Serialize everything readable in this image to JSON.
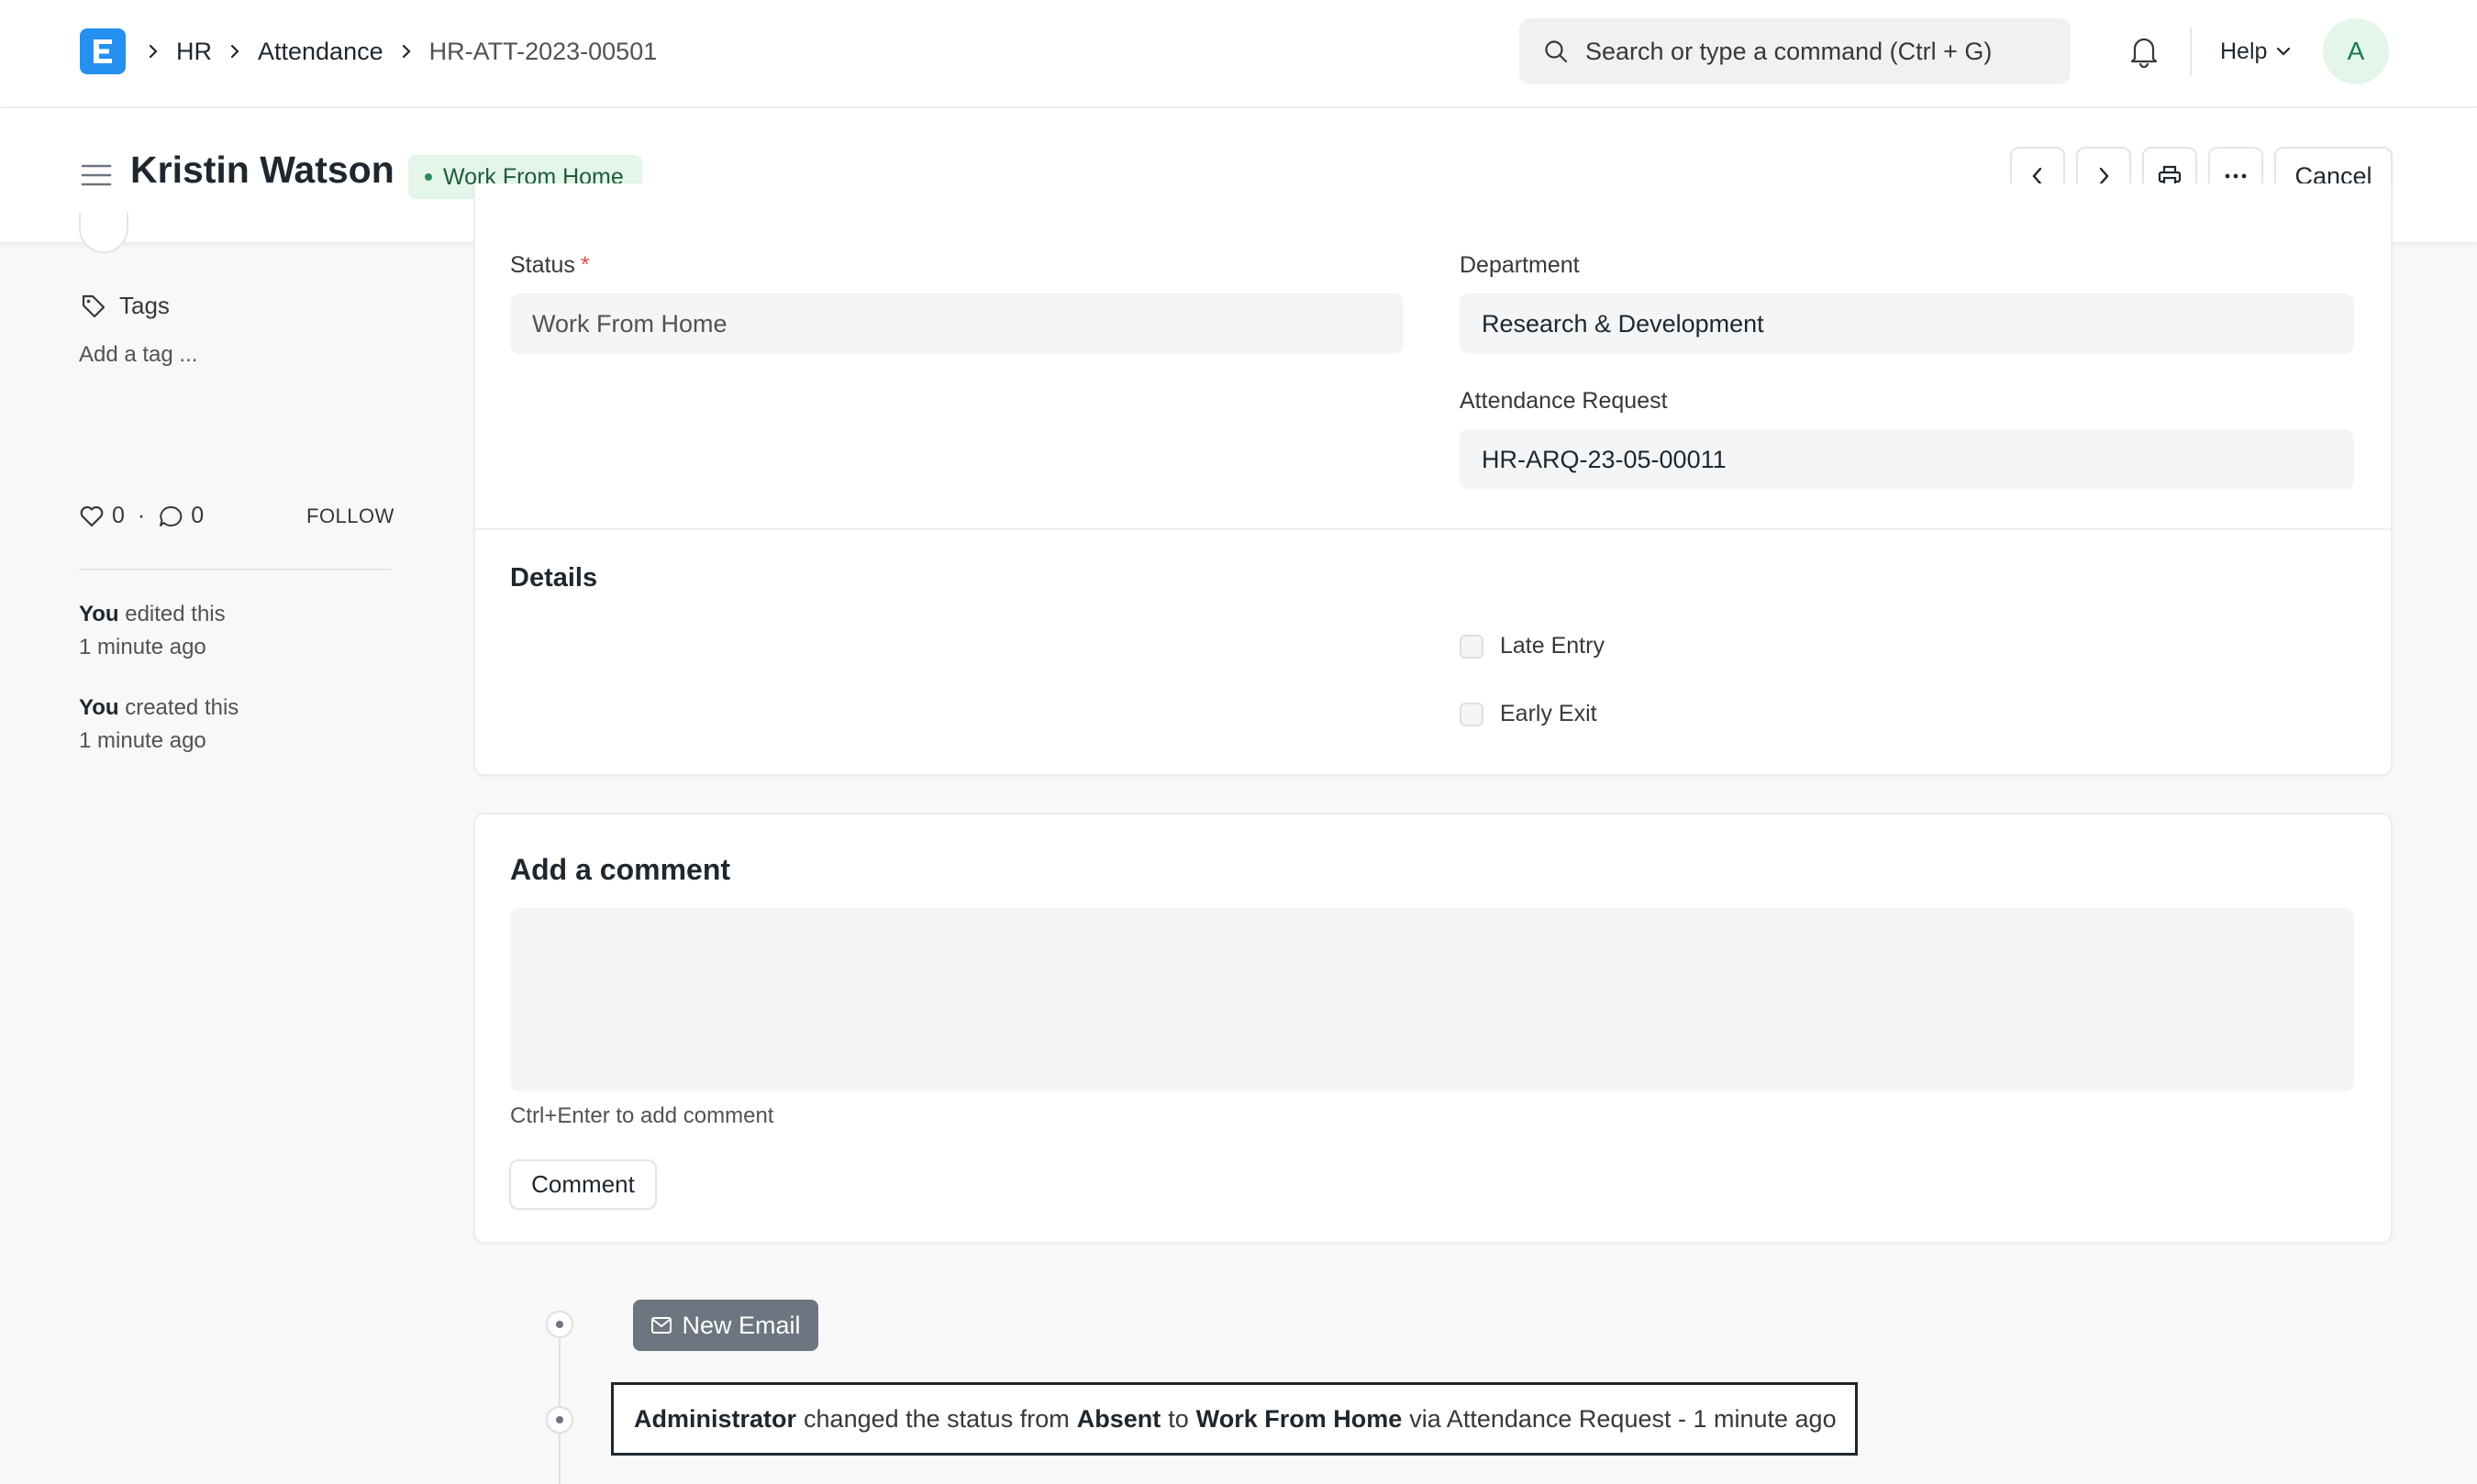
{
  "navbar": {
    "breadcrumbs": [
      "HR",
      "Attendance",
      "HR-ATT-2023-00501"
    ],
    "search_placeholder": "Search or type a command (Ctrl + G)",
    "help_label": "Help",
    "avatar_initial": "A"
  },
  "header": {
    "title": "Kristin Watson",
    "status": "Work From Home",
    "cancel_label": "Cancel"
  },
  "sidebar": {
    "tags_label": "Tags",
    "add_tag": "Add a tag ...",
    "likes": "0",
    "comments": "0",
    "follow_label": "FOLLOW",
    "activity": [
      {
        "who": "You",
        "action": "edited this",
        "when": "1 minute ago"
      },
      {
        "who": "You",
        "action": "created this",
        "when": "1 minute ago"
      }
    ]
  },
  "form": {
    "status_label": "Status",
    "status_value": "Work From Home",
    "department_label": "Department",
    "department_value": "Research & Development",
    "attendance_request_label": "Attendance Request",
    "attendance_request_value": "HR-ARQ-23-05-00011",
    "details_title": "Details",
    "late_entry_label": "Late Entry",
    "early_exit_label": "Early Exit"
  },
  "comment": {
    "title": "Add a comment",
    "hint": "Ctrl+Enter to add comment",
    "button_label": "Comment"
  },
  "timeline": {
    "new_email_label": "New Email",
    "entry": {
      "actor": "Administrator",
      "text1": "changed the status from",
      "from": "Absent",
      "text2": "to",
      "to": "Work From Home",
      "text3": "via Attendance Request - 1 minute ago"
    }
  },
  "colors": {
    "brand": "#2490ef",
    "status_bg": "#e4f5e9",
    "status_text": "#1f5d3a",
    "required": "#e24c4c"
  }
}
